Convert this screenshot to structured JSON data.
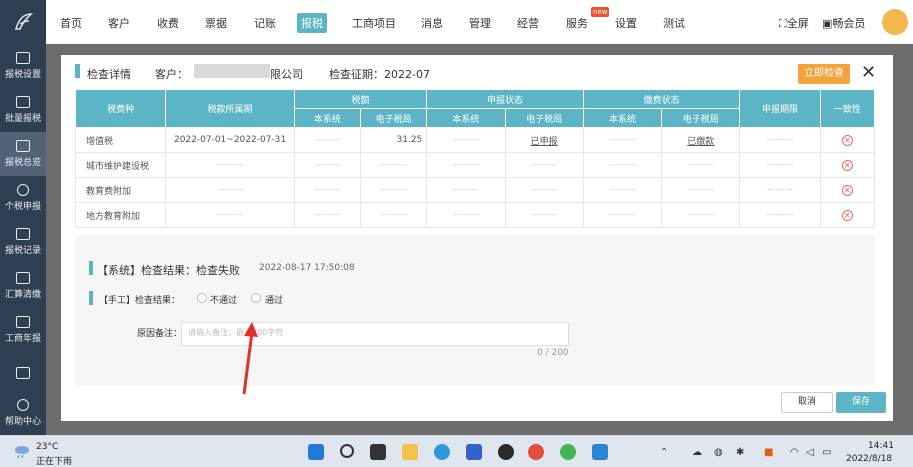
{
  "nav": {
    "items": [
      "首页",
      "客户",
      "收费",
      "票据",
      "记账",
      "报税",
      "工商项目",
      "消息",
      "管理",
      "经营",
      "服务",
      "设置",
      "测试"
    ],
    "active": "报税",
    "new_badge": "new",
    "fullscreen": "全屏",
    "member": "畅会员"
  },
  "sidebar": {
    "items": [
      "报税设置",
      "批量报税",
      "报税总览",
      "个税申报",
      "报税记录",
      "汇算清缴",
      "工商年报",
      "",
      "帮助中心"
    ]
  },
  "dialog": {
    "title": "检查详情",
    "customer_label": "客户：",
    "customer_name_suffix": "限公司",
    "period": "检查征期：2022-07",
    "check_button": "立即检查",
    "close": "✕",
    "table": {
      "group_headers": [
        "税额",
        "申报状态",
        "缴费状态"
      ],
      "headers": [
        "税费种",
        "税款所属期",
        "申报期限",
        "一致性"
      ],
      "sub_headers": [
        "本系统",
        "电子税局",
        "本系统",
        "电子税局",
        "本系统",
        "电子税局"
      ],
      "rows": [
        {
          "tax": "增值税",
          "period": "2022-07-01~2022-07-31",
          "amount": "31.25",
          "declare": "已申报",
          "payment": "已缴款"
        },
        {
          "tax": "城市维护建设税",
          "period": "",
          "amount": "",
          "declare": "",
          "payment": ""
        },
        {
          "tax": "教育费附加",
          "period": "",
          "amount": "",
          "declare": "",
          "payment": ""
        },
        {
          "tax": "地方教育附加",
          "period": "",
          "amount": "",
          "declare": "",
          "payment": ""
        }
      ]
    },
    "system_result": "【系统】检查结果：检查失败",
    "system_time": "2022-08-17 17:50:08",
    "manual_label": "【手工】检查结果：",
    "option_fail": "不通过",
    "option_pass": "通过",
    "reason_label": "原因备注：",
    "reason_placeholder": "请输入备注，最多200字符",
    "counter": "0 / 200",
    "cancel": "取消",
    "save": "保存"
  },
  "taskbar": {
    "temp": "23°C",
    "weather": "正在下雨",
    "time": "14:41",
    "date": "2022/8/18"
  }
}
